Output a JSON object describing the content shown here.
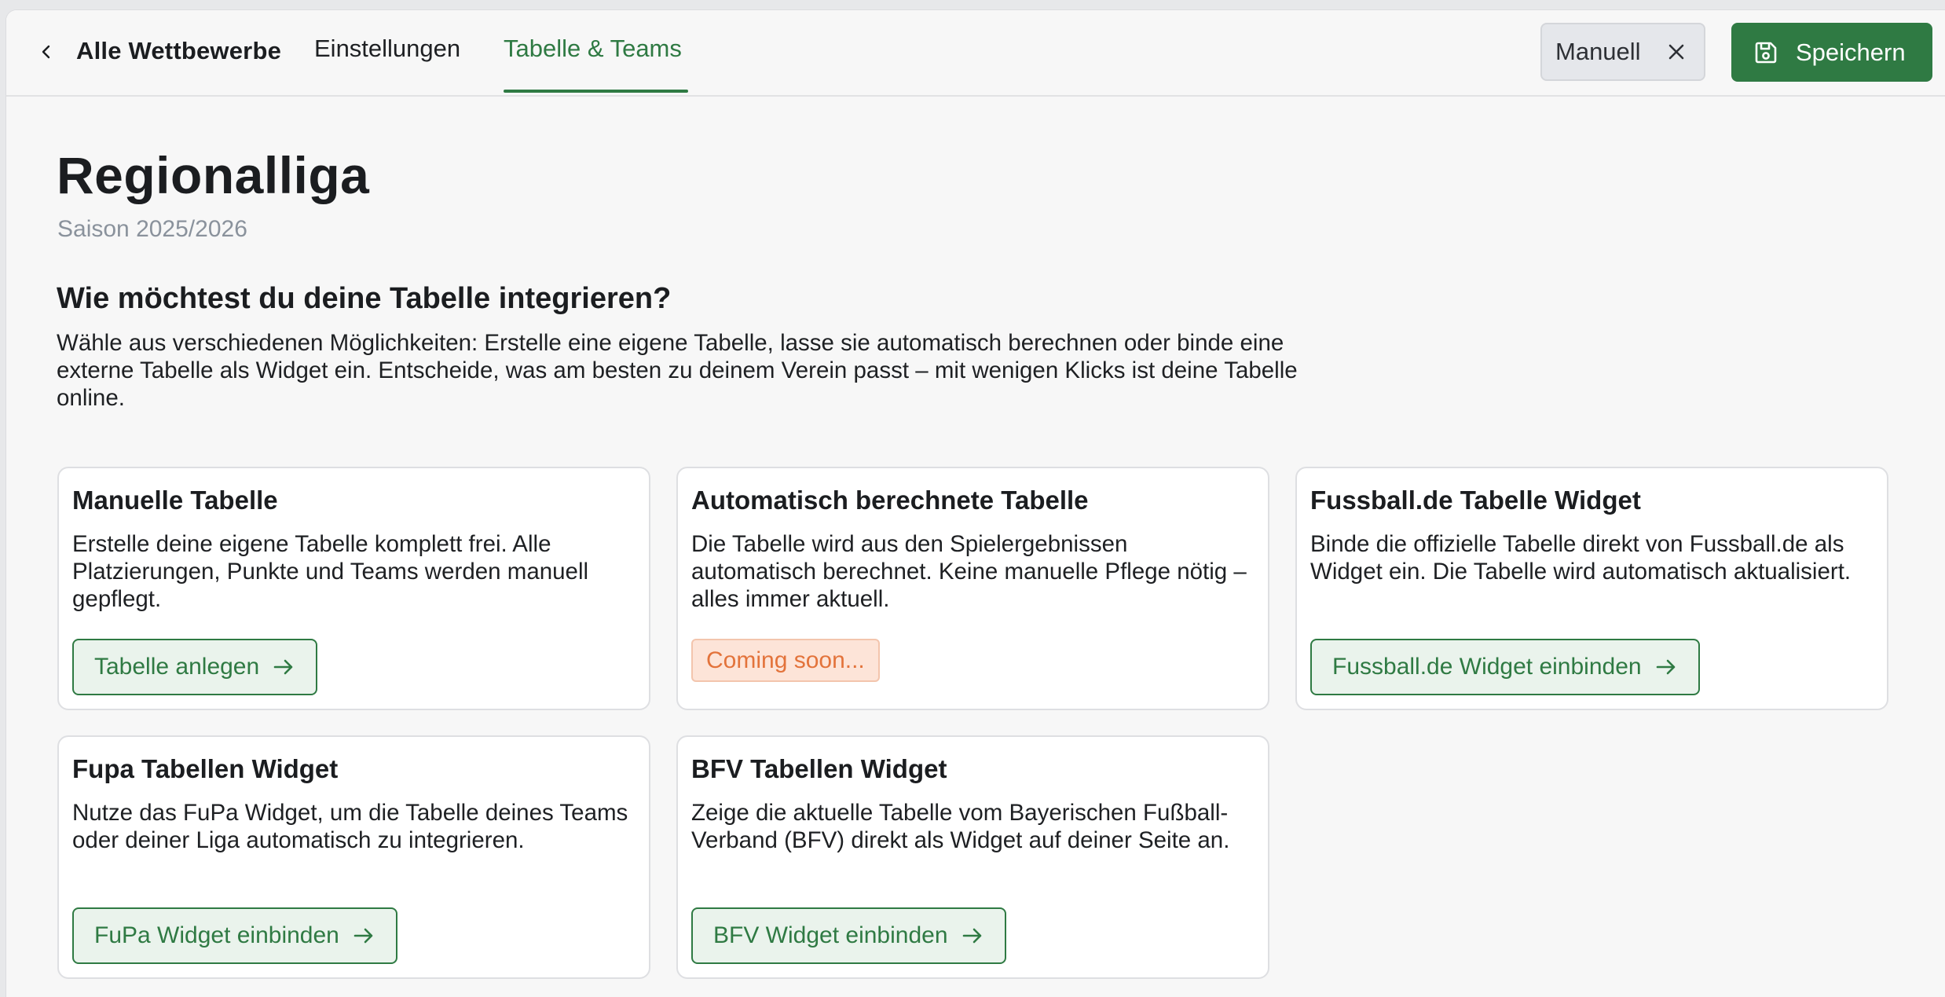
{
  "header": {
    "back_label": "Alle Wettbewerbe",
    "tabs": [
      {
        "label": "Einstellungen",
        "active": false
      },
      {
        "label": "Tabelle & Teams",
        "active": true
      }
    ],
    "mode_chip_label": "Manuell",
    "save_label": "Speichern"
  },
  "page": {
    "title": "Regionalliga",
    "season": "Saison 2025/2026"
  },
  "section": {
    "title": "Wie möchtest du deine Tabelle integrieren?",
    "description": "Wähle aus verschiedenen Möglichkeiten: Erstelle eine eigene Tabelle, lasse sie automatisch berechnen oder binde eine externe Tabelle als Widget ein. Entscheide, was am besten zu deinem Verein passt – mit wenigen Klicks ist deine Tabelle online."
  },
  "cards": [
    {
      "title": "Manuelle Tabelle",
      "description": "Erstelle deine eigene Tabelle komplett frei. Alle Platzierungen, Punkte und Teams werden manuell gepflegt.",
      "button_label": "Tabelle anlegen"
    },
    {
      "title": "Automatisch berechnete Tabelle",
      "description": "Die Tabelle wird aus den Spielergebnissen automatisch berechnet. Keine manuelle Pflege nötig – alles immer aktuell.",
      "badge_label": "Coming soon..."
    },
    {
      "title": "Fussball.de Tabelle Widget",
      "description": "Binde die offizielle Tabelle direkt von Fussball.de als Widget ein. Die Tabelle wird automatisch aktualisiert.",
      "button_label": "Fussball.de Widget einbinden"
    },
    {
      "title": "Fupa Tabellen Widget",
      "description": "Nutze das FuPa Widget, um die Tabelle deines Teams oder deiner Liga automatisch zu integrieren.",
      "button_label": "FuPa Widget einbinden"
    },
    {
      "title": "BFV Tabellen Widget",
      "description": "Zeige die aktuelle Tabelle vom Bayerischen Fußball-Verband (BFV) direkt als Widget auf deiner Seite an.",
      "button_label": "BFV Widget einbinden"
    }
  ],
  "colors": {
    "accent": "#2f7a43",
    "accent_soft": "#eaf3ec",
    "badge_bg": "#fde4d8",
    "badge_text": "#e3733b",
    "muted_text": "#8a929c"
  },
  "icons": {
    "back": "chevron-left-icon",
    "chip_remove": "close-icon",
    "save": "floppy-disk-icon",
    "card_button": "arrow-right-icon"
  }
}
